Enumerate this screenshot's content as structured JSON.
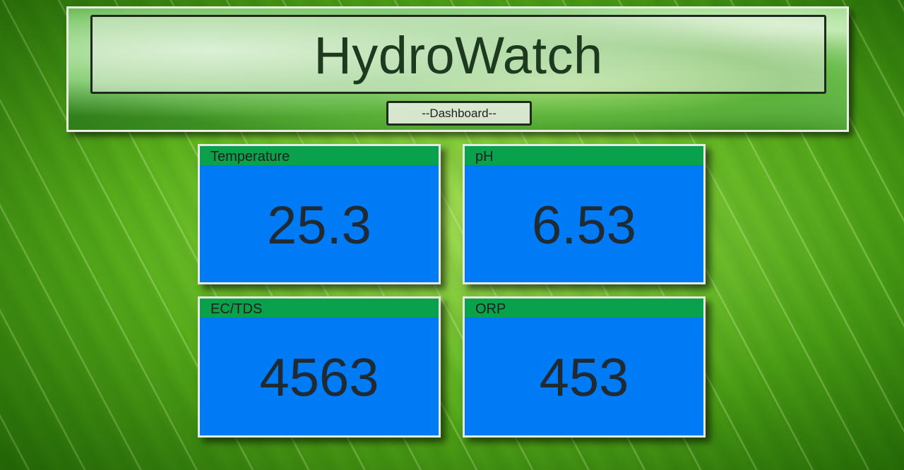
{
  "header": {
    "title": "HydroWatch",
    "subtitle_button": "--Dashboard--"
  },
  "sensors": [
    {
      "label": "Temperature",
      "value": "25.3"
    },
    {
      "label": "pH",
      "value": "6.53"
    },
    {
      "label": "EC/TDS",
      "value": "4563"
    },
    {
      "label": "ORP",
      "value": "453"
    }
  ],
  "colors": {
    "tile_background": "#007bf6",
    "tile_header": "#0aa14c",
    "title_text": "#1e3a1e"
  }
}
